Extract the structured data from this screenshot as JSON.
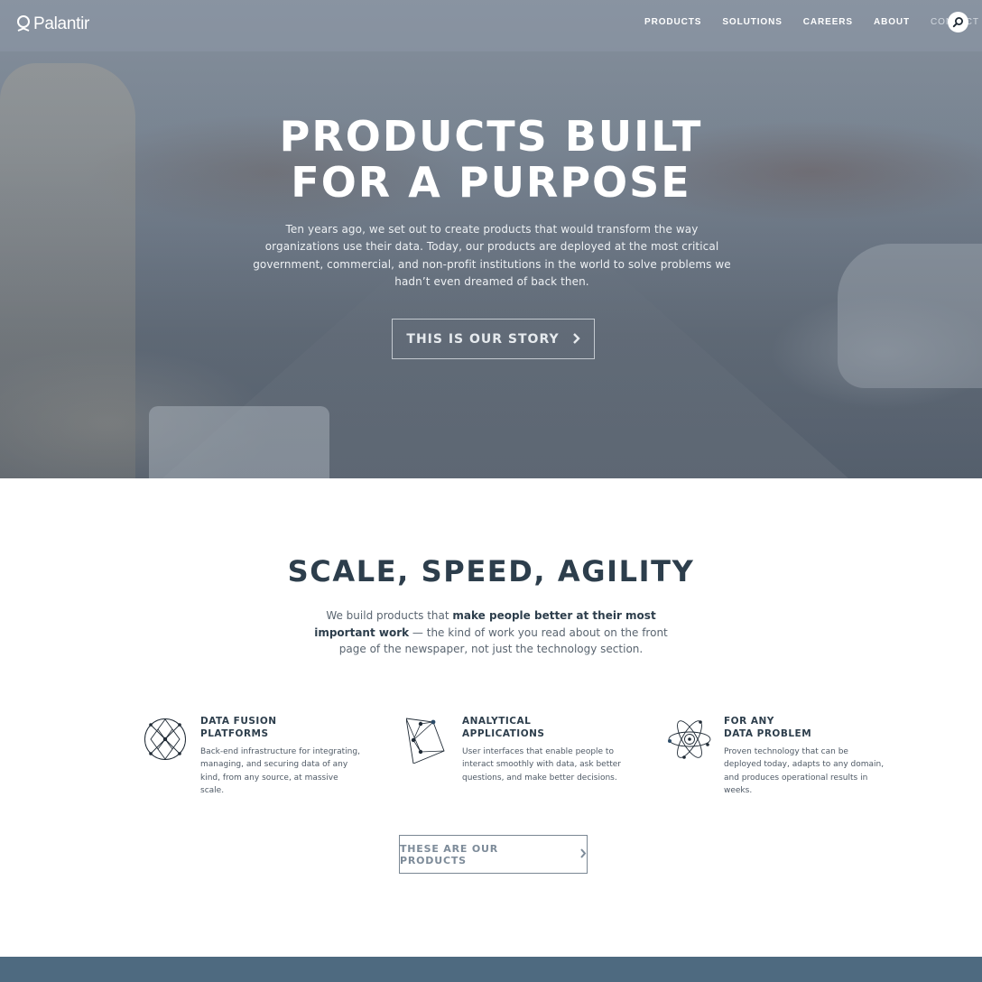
{
  "nav": {
    "logo": "Palantir",
    "links": [
      "PRODUCTS",
      "SOLUTIONS",
      "CAREERS",
      "ABOUT",
      "CONTACT"
    ]
  },
  "hero": {
    "title_line1": "PRODUCTS BUILT",
    "title_line2": "FOR A PURPOSE",
    "text": "Ten years ago, we set out to create products that would transform the way organizations use their data. Today, our products are deployed at the most critical government, commercial, and non-profit institutions in the world to solve problems we hadn’t even dreamed of back then.",
    "button": "THIS IS OUR STORY"
  },
  "section": {
    "title": "SCALE, SPEED, AGILITY",
    "text_before": "We build products that ",
    "text_bold": "make people better at their most important work",
    "text_after": " — the kind of work you read about on the front page of the newspaper, not just the technology section."
  },
  "features": [
    {
      "title_line1": "DATA FUSION",
      "title_line2": "PLATFORMS",
      "desc": "Back-end infrastructure for integrating, managing, and securing data of any kind, from any source, at massive scale."
    },
    {
      "title_line1": "ANALYTICAL",
      "title_line2": "APPLICATIONS",
      "desc": "User interfaces that enable people to interact smoothly with data, ask better questions, and make better decisions."
    },
    {
      "title_line1": "FOR ANY",
      "title_line2": "DATA PROBLEM",
      "desc": "Proven technology that can be deployed today, adapts to any domain, and produces operational results in weeks."
    }
  ],
  "products_button": "THESE ARE OUR PRODUCTS",
  "icons": {
    "logo": "palantir-logo-icon",
    "search": "search-icon",
    "chevron": "chevron-right-icon",
    "feature1": "data-fusion-icon",
    "feature2": "analytical-applications-icon",
    "feature3": "atom-icon"
  },
  "colors": {
    "heading": "#2d3e4c",
    "footer_band": "#4e6a80"
  }
}
